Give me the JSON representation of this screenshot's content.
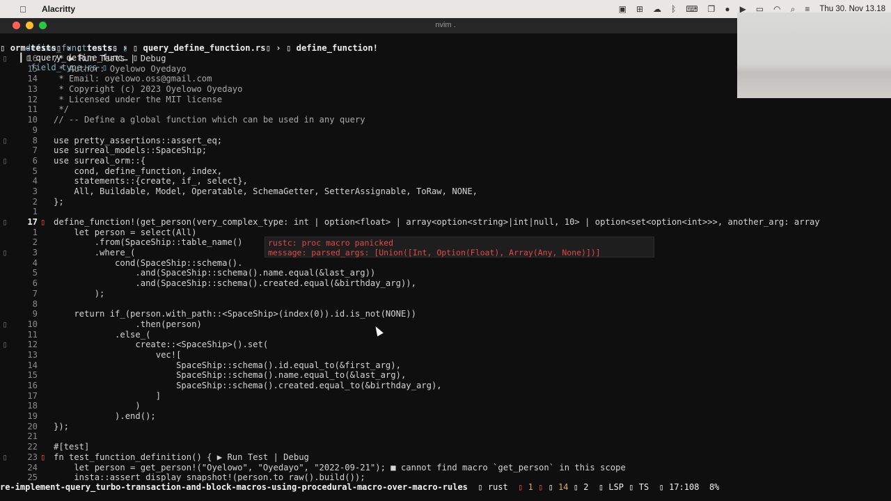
{
  "menubar": {
    "app_name": "Alacritty",
    "clock": "Thu 30. Nov 13.18",
    "icons": [
      "apple-icon",
      "screen-icon",
      "gamepad-icon",
      "cloud-icon",
      "bluetooth-icon",
      "keyboard-icon",
      "window-icon",
      "user-icon",
      "play-icon",
      "battery-icon",
      "wifi-icon",
      "search-icon",
      "control-center-icon"
    ]
  },
  "window": {
    "title": "nvim .",
    "traffic_light_colors": [
      "#ff5f57",
      "#febc2e",
      "#28c840"
    ]
  },
  "tabs": [
    {
      "label": "define_function.rs"
    },
    {
      "label": "query_define_func…"
    },
    {
      "label": "field_type.rs"
    }
  ],
  "breadcrumb": [
    "orm-tests",
    "tests",
    "query_define_function.rs",
    "define_function!"
  ],
  "code": [
    {
      "n": "16",
      "text": "/* ▶ Run Tests | Debug"
    },
    {
      "n": "15",
      "text": " * Author: Oyelowo Oyedayo"
    },
    {
      "n": "14",
      "text": " * Email: oyelowo.oss@gmail.com"
    },
    {
      "n": "13",
      "text": " * Copyright (c) 2023 Oyelowo Oyedayo"
    },
    {
      "n": "12",
      "text": " * Licensed under the MIT license"
    },
    {
      "n": "11",
      "text": " */"
    },
    {
      "n": "10",
      "text": "// -- Define a global function which can be used in any query"
    },
    {
      "n": "9",
      "text": ""
    },
    {
      "n": "8",
      "text": "use pretty_assertions::assert_eq;"
    },
    {
      "n": "7",
      "text": "use surreal_models::SpaceShip;"
    },
    {
      "n": "6",
      "text": "use surreal_orm::{"
    },
    {
      "n": "5",
      "text": "    cond, define_function, index,"
    },
    {
      "n": "4",
      "text": "    statements::{create, if_, select},"
    },
    {
      "n": "3",
      "text": "    All, Buildable, Model, Operatable, SchemaGetter, SetterAssignable, ToRaw, NONE,"
    },
    {
      "n": "2",
      "text": "};"
    },
    {
      "n": "1",
      "text": ""
    },
    {
      "n": "17",
      "text": "define_function!(get_person(very_complex_type: int | option<float> | array<option<string>|int|null, 10> | option<set<option<int>>>, another_arg: array"
    },
    {
      "n": "1",
      "text": "    let person = select(All)"
    },
    {
      "n": "2",
      "text": "        .from(SpaceShip::table_name()"
    },
    {
      "n": "3",
      "text": "        .where_("
    },
    {
      "n": "4",
      "text": "            cond(SpaceShip::schema()."
    },
    {
      "n": "5",
      "text": "                .and(SpaceShip::schema().name.equal(&last_arg))"
    },
    {
      "n": "6",
      "text": "                .and(SpaceShip::schema().created.equal(&birthday_arg)),"
    },
    {
      "n": "7",
      "text": "        );"
    },
    {
      "n": "8",
      "text": ""
    },
    {
      "n": "9",
      "text": "    return if_(person.with_path::<SpaceShip>(index(0)).id.is_not(NONE))"
    },
    {
      "n": "10",
      "text": "                .then(person)"
    },
    {
      "n": "11",
      "text": "            .else_("
    },
    {
      "n": "12",
      "text": "                create::<SpaceShip>().set("
    },
    {
      "n": "13",
      "text": "                    vec!["
    },
    {
      "n": "14",
      "text": "                        SpaceShip::schema().id.equal_to(&first_arg),"
    },
    {
      "n": "15",
      "text": "                        SpaceShip::schema().name.equal_to(&last_arg),"
    },
    {
      "n": "16",
      "text": "                        SpaceShip::schema().created.equal_to(&birthday_arg),"
    },
    {
      "n": "17",
      "text": "                    ]"
    },
    {
      "n": "18",
      "text": "                )"
    },
    {
      "n": "19",
      "text": "            ).end();"
    },
    {
      "n": "20",
      "text": "});"
    },
    {
      "n": "21",
      "text": ""
    },
    {
      "n": "22",
      "text": "#[test]"
    },
    {
      "n": "23",
      "text": "fn test_function_definition() { ▶ Run Test | Debug"
    },
    {
      "n": "24",
      "text": "    let person = get_person!(\"Oyelowo\", \"Oyedayo\", \"2022-09-21\"); ■ cannot find macro `get_person` in this scope"
    },
    {
      "n": "25",
      "text": "    insta::assert_display_snapshot!(person.to_raw().build());"
    }
  ],
  "hover": {
    "line1": "rustc: proc macro panicked",
    "line2": "message: parsed_args: [Union([Int, Option(Float), Array(Any, None)])]"
  },
  "statusline": {
    "branch": "re-implement-query_turbo-transaction-and-block-macros-using-procedural-macro-over-macro-rules",
    "filetype": "rust",
    "errors": "1",
    "warnings": "14",
    "hints": "2",
    "lsp": "LSP",
    "ts": "TS",
    "position": "17:108",
    "percent": "8%"
  }
}
